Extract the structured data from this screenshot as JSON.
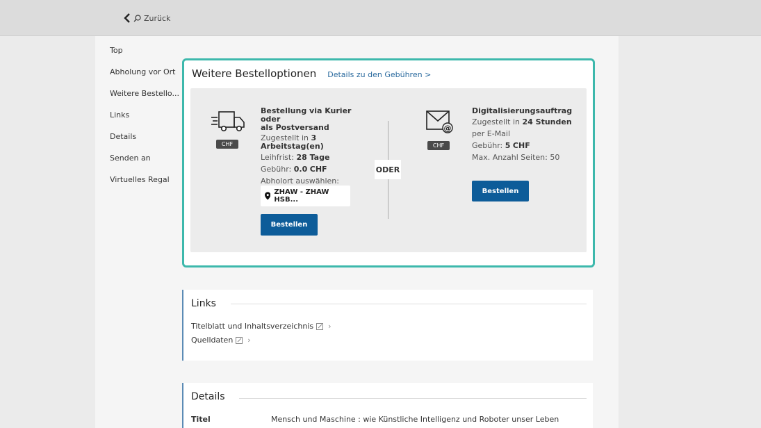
{
  "topbar": {
    "back_label": "Zurück"
  },
  "sidenav": {
    "items": [
      {
        "label": "Top"
      },
      {
        "label": "Abholung vor Ort"
      },
      {
        "label": "Weitere Bestello..."
      },
      {
        "label": "Links"
      },
      {
        "label": "Details"
      },
      {
        "label": "Senden an"
      },
      {
        "label": "Virtuelles Regal"
      }
    ]
  },
  "order": {
    "title": "Weitere Bestelloptionen",
    "fee_link": "Details zu den Gebühren >",
    "divider_label": "ODER",
    "courier": {
      "badge": "CHF",
      "title_line1": "Bestellung via Kurier oder",
      "title_line2": "als Postversand",
      "delivered_prefix": "Zugestellt in",
      "delivered_value": "3",
      "delivered_unit": "Arbeitstag(en)",
      "loan_label": "Leihfrist:",
      "loan_value": "28 Tage",
      "fee_label": "Gebühr:",
      "fee_value": "0.0",
      "fee_currency": "CHF",
      "pickup_label": "Abholort auswählen:",
      "pickup_value": "ZHAW - ZHAW HSB...",
      "order_button": "Bestellen"
    },
    "digital": {
      "badge": "CHF",
      "title": "Digitalisierungsauftrag",
      "delivered_prefix": "Zugestellt in",
      "delivered_value": "24 Stunden",
      "via": "per E-Mail",
      "fee_label": "Gebühr:",
      "fee_value": "5",
      "fee_currency": "CHF",
      "pages_label": "Max. Anzahl Seiten: 50",
      "order_button": "Bestellen"
    }
  },
  "links_card": {
    "heading": "Links",
    "items": [
      {
        "label": "Titelblatt und Inhaltsverzeichnis"
      },
      {
        "label": "Quelldaten"
      }
    ]
  },
  "details_card": {
    "heading": "Details",
    "rows": [
      {
        "key": "Titel",
        "value": "Mensch und Maschine : wie Künstliche Intelligenz und Roboter unser Leben"
      }
    ]
  },
  "colors": {
    "accent_teal": "#3db8ac",
    "primary_blue": "#0d5c99",
    "link_blue": "#2a6a9e"
  }
}
